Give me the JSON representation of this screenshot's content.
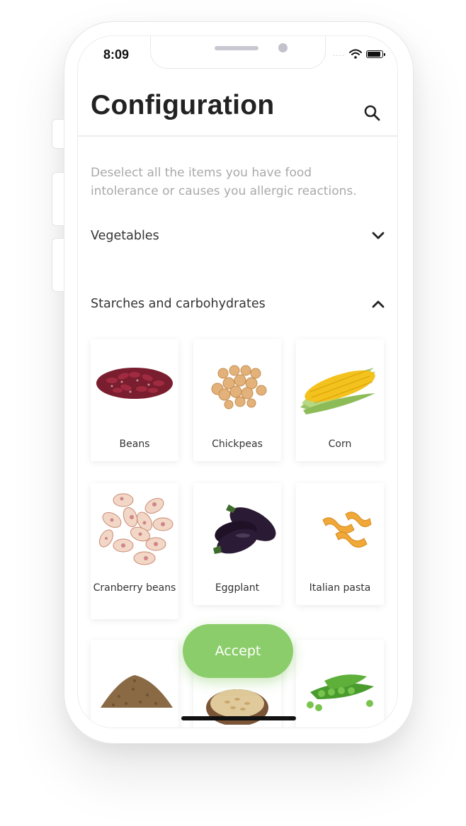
{
  "status_bar": {
    "time": "8:09",
    "signal": "....",
    "wifi_icon": "wifi-icon",
    "battery_icon": "battery-icon"
  },
  "header": {
    "title": "Configuration",
    "search_icon": "search-icon"
  },
  "description": "Deselect all the items you have food intolerance or causes you allergic reactions.",
  "sections": [
    {
      "label": "Vegetables",
      "state": "collapsed",
      "icon": "chevron-down-icon"
    },
    {
      "label": "Starches and carbohydrates",
      "state": "expanded",
      "icon": "chevron-up-icon"
    }
  ],
  "items": [
    {
      "label": "Beans"
    },
    {
      "label": "Chickpeas"
    },
    {
      "label": "Corn"
    },
    {
      "label": "Cranberry beans"
    },
    {
      "label": "Eggplant"
    },
    {
      "label": "Italian pasta"
    },
    {
      "label": ""
    },
    {
      "label": ""
    },
    {
      "label": ""
    }
  ],
  "accept_button": {
    "label": "Accept"
  },
  "colors": {
    "accent": "#8bcd6a",
    "title": "#222222",
    "description": "#a9a9a9"
  }
}
